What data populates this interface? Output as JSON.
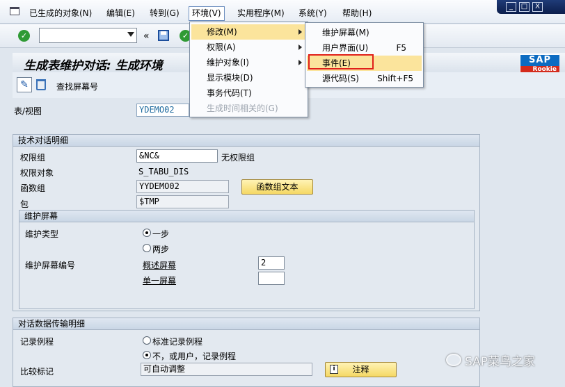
{
  "menubar": {
    "items": [
      "已生成的对象(N)",
      "编辑(E)",
      "转到(G)",
      "环境(V)",
      "实用程序(M)",
      "系统(Y)",
      "帮助(H)"
    ],
    "active_item": "环境(V)",
    "window_controls": [
      "_",
      "□",
      "X"
    ]
  },
  "toolbar": {
    "command_field_value": "",
    "back_symbol": "«"
  },
  "title": {
    "text": "生成表维护对话: 生成环境"
  },
  "logo": {
    "brand": "SAP",
    "sub": "Rookie"
  },
  "app_toolbar": {
    "find_screen_label": "查找屏幕号"
  },
  "table_view": {
    "label": "表/视图",
    "value": "YDEMO02"
  },
  "tech_details": {
    "header": "技术对话明细",
    "auth_group_label": "权限组",
    "auth_group_value": "&NC&",
    "auth_group_desc": "无权限组",
    "auth_object_label": "权限对象",
    "auth_object_value": "S_TABU_DIS",
    "function_group_label": "函数组",
    "function_group_value": "YYDEMO02",
    "function_group_text_button": "函数组文本",
    "package_label": "包",
    "package_value": "$TMP"
  },
  "maint_screen": {
    "header": "维护屏幕",
    "type_label": "维护类型",
    "type_options": [
      "一步",
      "两步"
    ],
    "type_selected": "一步",
    "screen_no_label": "维护屏幕编号",
    "overview_label": "概述屏幕",
    "overview_value": "2",
    "single_label": "单一屏幕",
    "single_value": ""
  },
  "transport": {
    "header": "对话数据传输明细",
    "record_routine_label": "记录例程",
    "record_options": [
      "标准记录例程",
      "不，或用户，记录例程"
    ],
    "record_selected": "不，或用户，记录例程",
    "compare_flag_label": "比较标记",
    "compare_flag_value": "可自动调整",
    "notes_button": "注释"
  },
  "env_menu": {
    "items": [
      {
        "label": "修改(M)",
        "submenu": true,
        "highlighted": true,
        "disabled": false
      },
      {
        "label": "权限(A)",
        "submenu": true,
        "highlighted": false,
        "disabled": false
      },
      {
        "label": "维护对象(I)",
        "submenu": true,
        "highlighted": false,
        "disabled": false
      },
      {
        "label": "显示模块(D)",
        "submenu": false,
        "highlighted": false,
        "disabled": false
      },
      {
        "label": "事务代码(T)",
        "submenu": false,
        "highlighted": false,
        "disabled": false
      },
      {
        "label": "生成时间相关的(G)",
        "submenu": false,
        "highlighted": false,
        "disabled": true
      }
    ]
  },
  "modify_submenu": {
    "items": [
      {
        "label": "维护屏幕(M)",
        "shortcut": "",
        "highlighted": false
      },
      {
        "label": "用户界面(U)",
        "shortcut": "F5",
        "highlighted": false
      },
      {
        "label": "事件(E)",
        "shortcut": "",
        "highlighted": true
      },
      {
        "label": "源代码(S)",
        "shortcut": "Shift+F5",
        "highlighted": false
      }
    ]
  },
  "watermark": {
    "text": "SAP菜鸟之家"
  },
  "colors": {
    "highlight": "#fbe49c",
    "accent_red": "#e0201a",
    "button_yellow": "#f5d864",
    "sap_blue": "#0c6bc1"
  }
}
